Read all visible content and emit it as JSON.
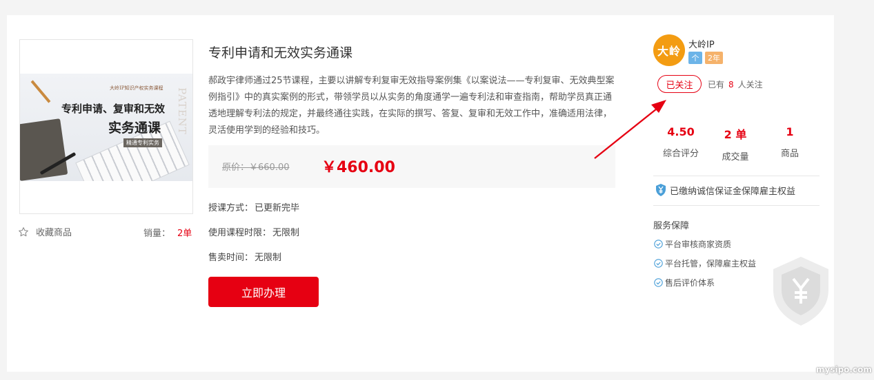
{
  "product": {
    "title": "专利申请和无效实务通课",
    "description": "郝政宇律师通过25节课程，主要以讲解专利复审无效指导案例集《以案说法——专利复审、无效典型案例指引》中的真实案例的形式，带领学员以从实务的角度通学一遍专利法和审查指南，帮助学员真正通透地理解专利法的规定，并最终通往实践，在实际的撰写、答复、复审和无效工作中，准确适用法律，灵活使用学到的经验和技巧。",
    "original_price_label": "原价：",
    "original_price": "￥660.00",
    "price": "￥460.00",
    "teaching_method_label": "授课方式：",
    "teaching_method": "已更新完毕",
    "duration_label": "使用课程时限：",
    "duration": "无限制",
    "sale_time_label": "售卖时间：",
    "sale_time": "无限制",
    "buy_label": "立即办理",
    "favorite_label": "收藏商品",
    "sales_label": "销量：",
    "sales_count": "2单",
    "image": {
      "small_heading": "大岭IP知识产权实务课程",
      "line1": "专利申请、复审和无效",
      "line2": "实务通课",
      "tag": "精通专利实务",
      "side_word": "PATENT"
    }
  },
  "shop": {
    "avatar_text": "大岭",
    "name": "大岭IP",
    "badge_type": "个",
    "badge_years": "2年",
    "follow_label": "已关注",
    "followers_prefix": "已有",
    "followers_count": "8",
    "followers_suffix": "人关注",
    "stats": [
      {
        "value": "4.50",
        "label": "综合评分"
      },
      {
        "value": "2 单",
        "label": "成交量"
      },
      {
        "value": "1",
        "label": "商品"
      }
    ],
    "guarantee": "已缴纳诚信保证金保障雇主权益",
    "service_title": "服务保障",
    "services": [
      "平台审核商家资质",
      "平台托管，保障雇主权益",
      "售后评价体系"
    ]
  },
  "watermark": "mysipo.com",
  "colors": {
    "accent": "#e60012",
    "avatar": "#f39c12",
    "badge_blue": "#6cb4e8",
    "badge_orange": "#f5b26b",
    "check": "#4a9fd8"
  },
  "icons": [
    "star-outline-icon",
    "shield-yen-icon",
    "check-circle-icon",
    "red-arrow-annotation"
  ]
}
